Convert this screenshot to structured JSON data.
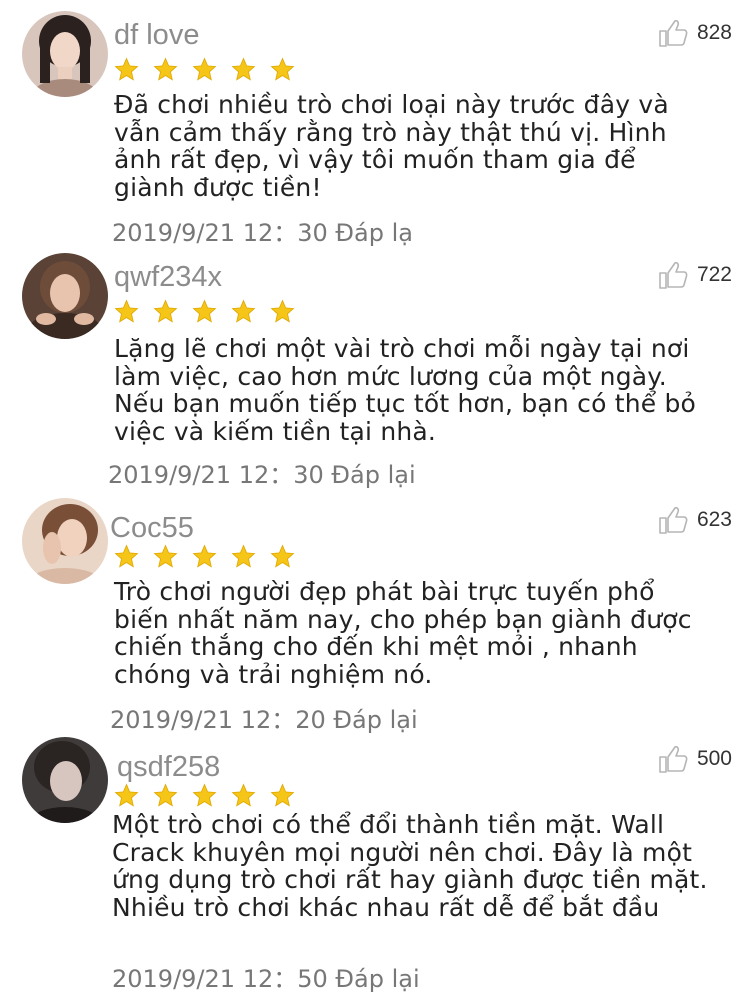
{
  "colors": {
    "star": "#f5c518",
    "username": "#8c8c8c",
    "body_text": "#222222",
    "meta_text": "#777777"
  },
  "icons": {
    "like": "thumbs-up-icon",
    "rating": "star-icon"
  },
  "comments": [
    {
      "username": "df love",
      "likes": "828",
      "rating": 5,
      "text": "Đã chơi nhiều trò chơi loại này trước đây và vẫn cảm thấy rằng trò này thật thú vị. Hình ảnh rất đẹp, vì vậy tôi muốn tham gia để giành được tiền!",
      "timestamp": "2019/9/21 12：30",
      "reply_label": "Đáp lạ"
    },
    {
      "username": "qwf234x",
      "likes": "722",
      "rating": 5,
      "text": "Lặng lẽ chơi một vài trò chơi mỗi ngày tại nơi làm việc, cao hơn mức lương của một ngày. Nếu bạn muốn tiếp tục tốt hơn, bạn có thể bỏ việc và kiếm tiền tại nhà.",
      "timestamp": "2019/9/21 12：30",
      "reply_label": "Đáp lại"
    },
    {
      "username": "Coc55",
      "likes": "623",
      "rating": 5,
      "text": "Trò chơi người đẹp phát bài trực tuyến phổ biến nhất năm nay, cho phép bạn giành được chiến thắng cho đến khi mệt mỏi , nhanh chóng và trải nghiệm nó.",
      "timestamp": "2019/9/21 12：20",
      "reply_label": "Đáp lại"
    },
    {
      "username": "qsdf258",
      "likes": "500",
      "rating": 5,
      "text": "Một trò chơi có thể đổi thành tiền mặt. Wall Crack khuyên mọi người nên chơi. Đây là một ứng dụng trò chơi rất hay giành được tiền mặt. Nhiều trò chơi khác nhau rất dễ để bắt đầu",
      "timestamp": "2019/9/21 12：50",
      "reply_label": "Đáp lại"
    }
  ]
}
